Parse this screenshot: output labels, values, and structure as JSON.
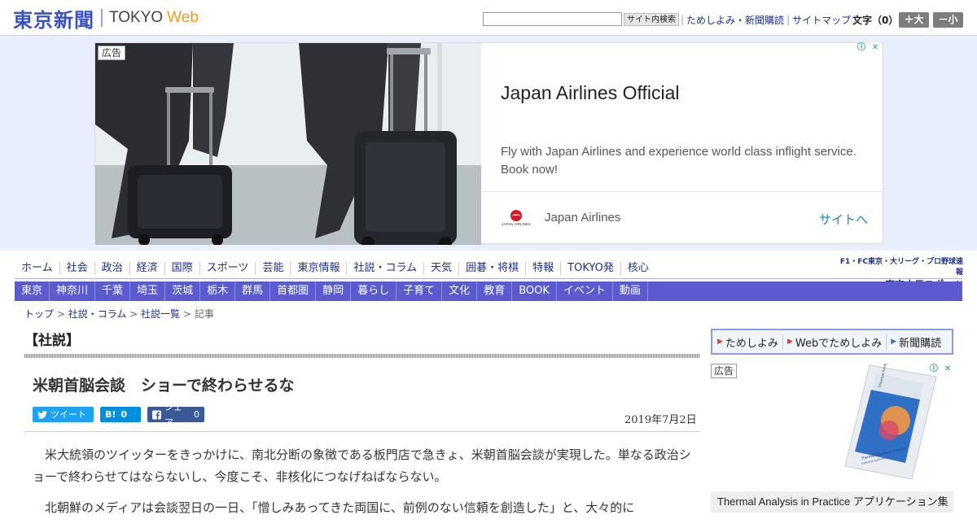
{
  "header": {
    "logo_jp": "東京新聞",
    "logo_en": "TOKYO",
    "logo_web": "Web",
    "search_button": "サイト内検索",
    "utility_links": [
      "ためしよみ・新聞購読",
      "サイトマップ"
    ],
    "fontsize_label": "文字（0）",
    "fontsize_up": "＋大",
    "fontsize_down": "－小"
  },
  "ad": {
    "label": "広告",
    "headline": "Japan Airlines Official",
    "body": "Fly with Japan Airlines and experience world class inflight service. Book now!",
    "brand": "Japan Airlines",
    "cta": "サイトへ",
    "logo_text": "JAPAN AIRLINES",
    "info_icon": "ⓘ",
    "close_icon": "✕"
  },
  "nav": {
    "main": [
      "ホーム",
      "社会",
      "政治",
      "経済",
      "国際",
      "スポーツ",
      "芸能",
      "東京情報",
      "社説・コラム",
      "天気",
      "囲碁・将棋",
      "特報",
      "TOKYO発",
      "核心"
    ],
    "region": [
      "東京",
      "神奈川",
      "千葉",
      "埼玉",
      "茨城",
      "栃木",
      "群馬",
      "首都圏",
      "静岡",
      "暮らし",
      "子育て",
      "文化",
      "教育",
      "BOOK",
      "イベント",
      "動画"
    ],
    "chunichi_top": "F1・FC東京・大リーグ・プロ野球速報",
    "chunichi_bottom": "▶東京中日スポーツ"
  },
  "breadcrumb": {
    "items": [
      "トップ",
      "社説・コラム",
      "社説一覧"
    ],
    "current": "記事",
    "separator": " > "
  },
  "article": {
    "section": "【社説】",
    "headline": "米朝首脳会談　ショーで終わらせるな",
    "date": "2019年7月2日",
    "share": {
      "tweet": "ツイート",
      "hatena": "B!",
      "hatena_count": "0",
      "facebook": "シェア",
      "facebook_count": "0"
    },
    "paragraphs": [
      "米大統領のツイッターをきっかけに、南北分断の象徴である板門店で急きょ、米朝首脳会談が実現した。単なる政治ショーで終わらせてはならないし、今度こそ、非核化につなげねばならない。",
      "北朝鮮のメディアは会談翌日の一日、「憎しみあってきた両国に、前例のない信頼を創造した」と、大々的に"
    ]
  },
  "sidebar": {
    "promo": [
      "ためしよみ",
      "Webでためしよみ",
      "新聞購読"
    ],
    "ad_label": "広告",
    "ad_caption": "Thermal Analysis in Practice アプリケーション集",
    "book_title": "Thermal Analysis in Practice",
    "book_subtitle": "Collected Applications",
    "book_series": "Thermal Analysis"
  }
}
